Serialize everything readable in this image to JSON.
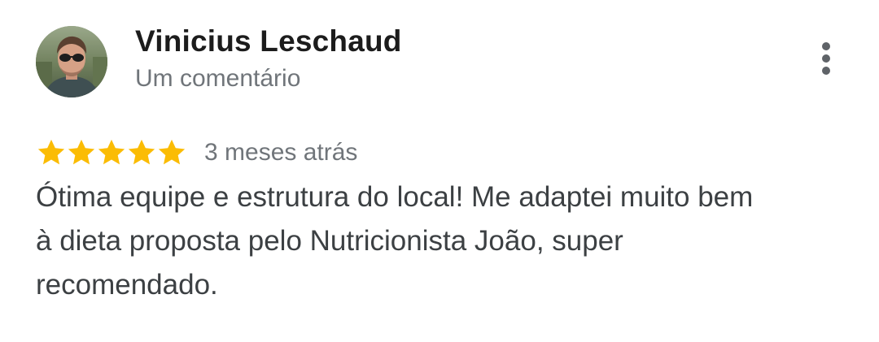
{
  "review": {
    "author": {
      "name": "Vinicius Leschaud",
      "meta": "Um comentário",
      "avatar_icon": "user-photo-avatar"
    },
    "rating": {
      "value": 5,
      "max": 5,
      "star_color": "#fbbc04",
      "star_icon": "star-icon"
    },
    "time": "3 meses atrás",
    "text": "Ótima equipe e estrutura do local! Me adaptei muito bem à dieta proposta pelo Nutricionista João, super recomendado.",
    "menu_icon": "more-vert-icon"
  },
  "colors": {
    "name": "#1c1c1c",
    "secondary": "#70757a",
    "body": "#3c4043",
    "icon": "#5f6368"
  }
}
